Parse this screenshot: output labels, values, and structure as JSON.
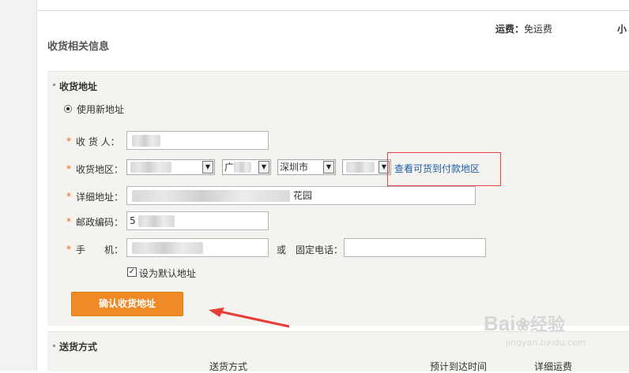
{
  "header": {
    "shipping_label": "运费：",
    "shipping_value": "免运费",
    "subtotal_partial": "小"
  },
  "section_title": "收货相关信息",
  "address_panel": {
    "title": "收货地址",
    "use_new_address": "使用新地址",
    "recipient_label": "收 货 人：",
    "region_label": "收货地区：",
    "region_select_2": "广",
    "region_select_3": "深圳市",
    "check_cod_link": "查看可货到付款地区",
    "detail_label": "详细地址：",
    "detail_value_partial": "花园",
    "postcode_label": "邮政编码：",
    "postcode_value": "5",
    "mobile_label": "手　　机：",
    "or_label": "或",
    "landline_label": "固定电话：",
    "set_default_label": "设为默认地址",
    "confirm_button": "确认收货地址"
  },
  "delivery_panel": {
    "title": "送货方式",
    "col_method": "送货方式",
    "col_eta": "预计到达时间",
    "col_fee": "详细运费"
  },
  "watermark": {
    "brand": "Bai",
    "brand_cn": "经验",
    "url": "jingyan.baidu.com"
  },
  "colors": {
    "accent_orange": "#f08a26",
    "highlight_red": "#e0463f",
    "link_blue": "#1d5ea7",
    "panel_bg": "#f5f3ef"
  },
  "icons": {
    "radio": "radio-selected-icon",
    "checkbox": "checkbox-checked-icon",
    "dropdown": "chevron-down-icon",
    "annotation": "red-arrow-icon"
  }
}
